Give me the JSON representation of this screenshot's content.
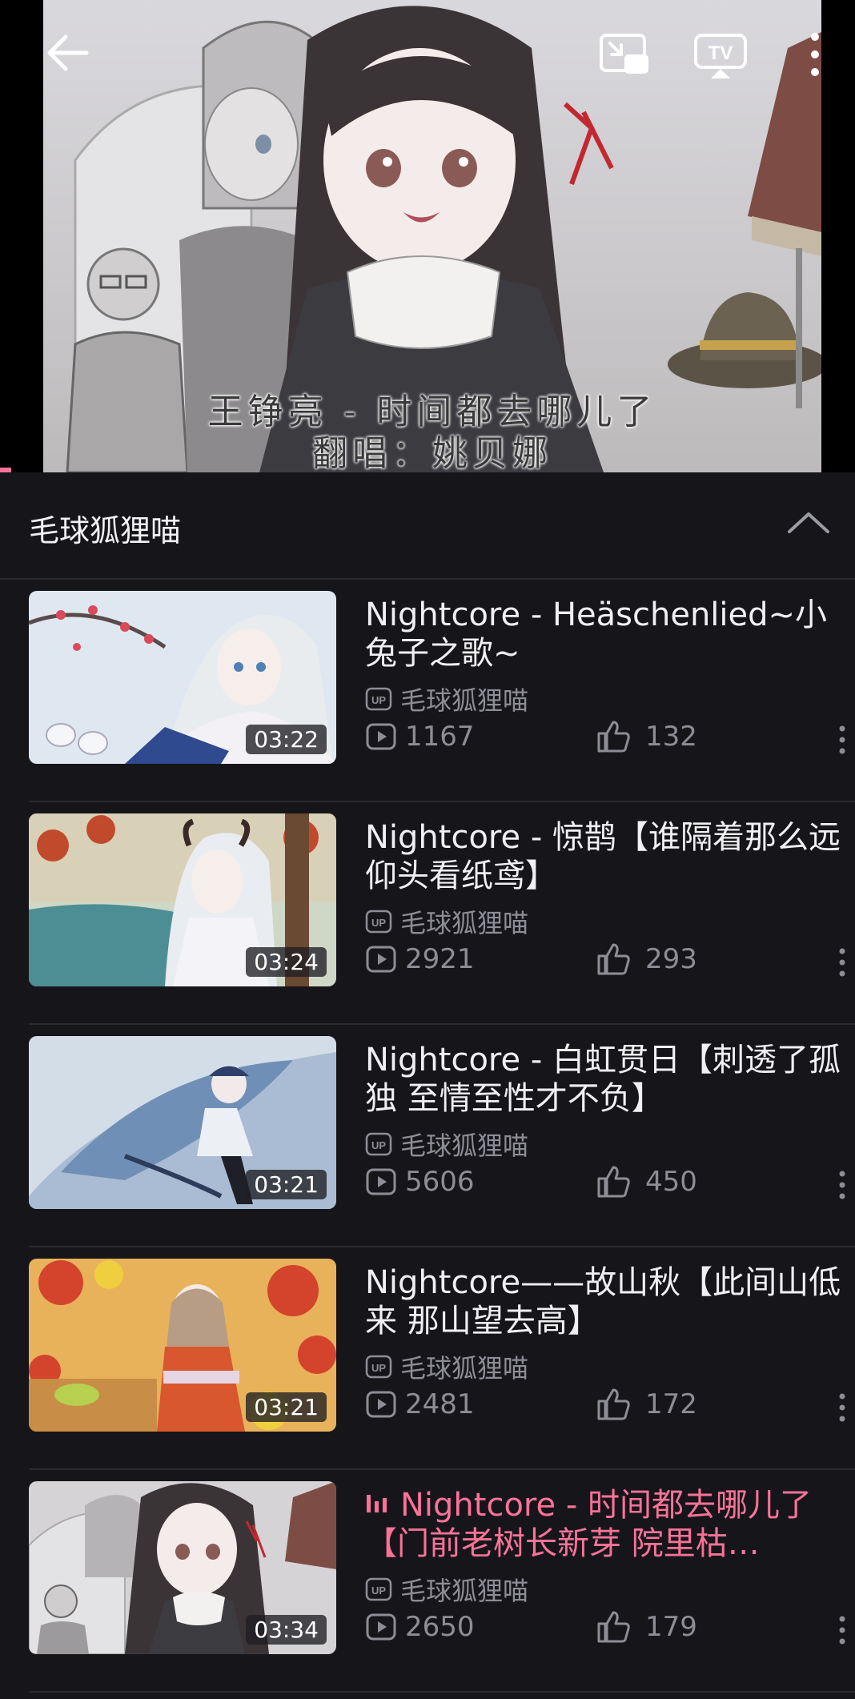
{
  "player": {
    "subtitle_line1": "王铮亮 - 时间都去哪儿了",
    "subtitle_line2": "翻唱：姚贝娜",
    "progress_fraction": 0.01,
    "icons": [
      "back-arrow-icon",
      "picture-in-picture-icon",
      "tv-cast-icon",
      "more-vertical-icon"
    ]
  },
  "panel": {
    "title": "毛球狐狸喵",
    "collapse_icon": "chevron-up-icon"
  },
  "colors": {
    "accent": "#fb7299",
    "background": "#16161a",
    "text_primary": "#f0f0f3",
    "text_secondary": "#8d8d96"
  },
  "videos": [
    {
      "title": "Nightcore - Heäschenlied~小兔子之歌~",
      "uploader": "毛球狐狸喵",
      "duration": "03:22",
      "plays": "1167",
      "likes": "132",
      "playing": false
    },
    {
      "title": "Nightcore - 惊鹊【谁隔着那么远 仰头看纸鸢】",
      "uploader": "毛球狐狸喵",
      "duration": "03:24",
      "plays": "2921",
      "likes": "293",
      "playing": false
    },
    {
      "title": "Nightcore - 白虹贯日【刺透了孤独 至情至性才不负】",
      "uploader": "毛球狐狸喵",
      "duration": "03:21",
      "plays": "5606",
      "likes": "450",
      "playing": false
    },
    {
      "title": "Nightcore——故山秋【此间山低来 那山望去高】",
      "uploader": "毛球狐狸喵",
      "duration": "03:21",
      "plays": "2481",
      "likes": "172",
      "playing": false
    },
    {
      "title": "Nightcore - 时间都去哪儿了【门前老树长新芽 院里枯…",
      "uploader": "毛球狐狸喵",
      "duration": "03:34",
      "plays": "2650",
      "likes": "179",
      "playing": true
    }
  ]
}
